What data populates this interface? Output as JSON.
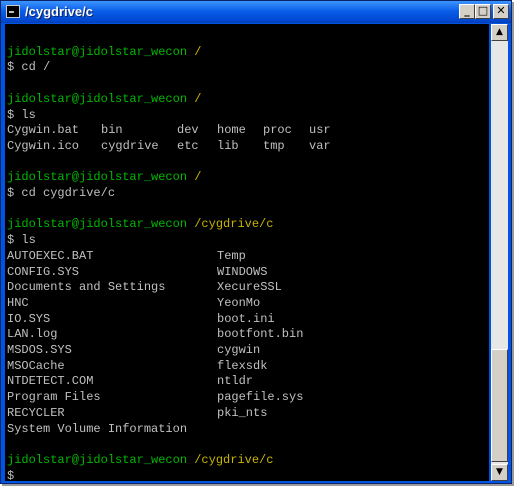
{
  "window": {
    "title": "/cygdrive/c",
    "minimize_glyph": "_",
    "maximize_glyph": "□",
    "close_glyph": "✕"
  },
  "colors": {
    "user_host": "#00b800",
    "path": "#c8b400",
    "text": "#c0c0c0",
    "background": "#000000"
  },
  "terminal": {
    "user_host": "jidolstar@jidolstar_wecon",
    "prompts": [
      {
        "path": "/",
        "command": "$ cd /"
      },
      {
        "path": "/",
        "command": "$ ls"
      },
      {
        "path": "/",
        "command": "$ cd cygdrive/c"
      },
      {
        "path": "/cygdrive/c",
        "command": "$ ls"
      },
      {
        "path": "/cygdrive/c",
        "command": "$"
      }
    ],
    "root_ls": [
      [
        "Cygwin.bat",
        "bin",
        "dev",
        "home",
        "proc",
        "usr"
      ],
      [
        "Cygwin.ico",
        "cygdrive",
        "etc",
        "lib",
        "tmp",
        "var"
      ]
    ],
    "c_ls": [
      [
        "AUTOEXEC.BAT",
        "Temp"
      ],
      [
        "CONFIG.SYS",
        "WINDOWS"
      ],
      [
        "Documents and Settings",
        "XecureSSL"
      ],
      [
        "HNC",
        "YeonMo"
      ],
      [
        "IO.SYS",
        "boot.ini"
      ],
      [
        "LAN.log",
        "bootfont.bin"
      ],
      [
        "MSDOS.SYS",
        "cygwin"
      ],
      [
        "MSOCache",
        "flexsdk"
      ],
      [
        "NTDETECT.COM",
        "ntldr"
      ],
      [
        "Program Files",
        "pagefile.sys"
      ],
      [
        "RECYCLER",
        "pki_nts"
      ],
      [
        "System Volume Information",
        ""
      ]
    ]
  },
  "scrollbar": {
    "up_glyph": "▲",
    "down_glyph": "▼"
  }
}
